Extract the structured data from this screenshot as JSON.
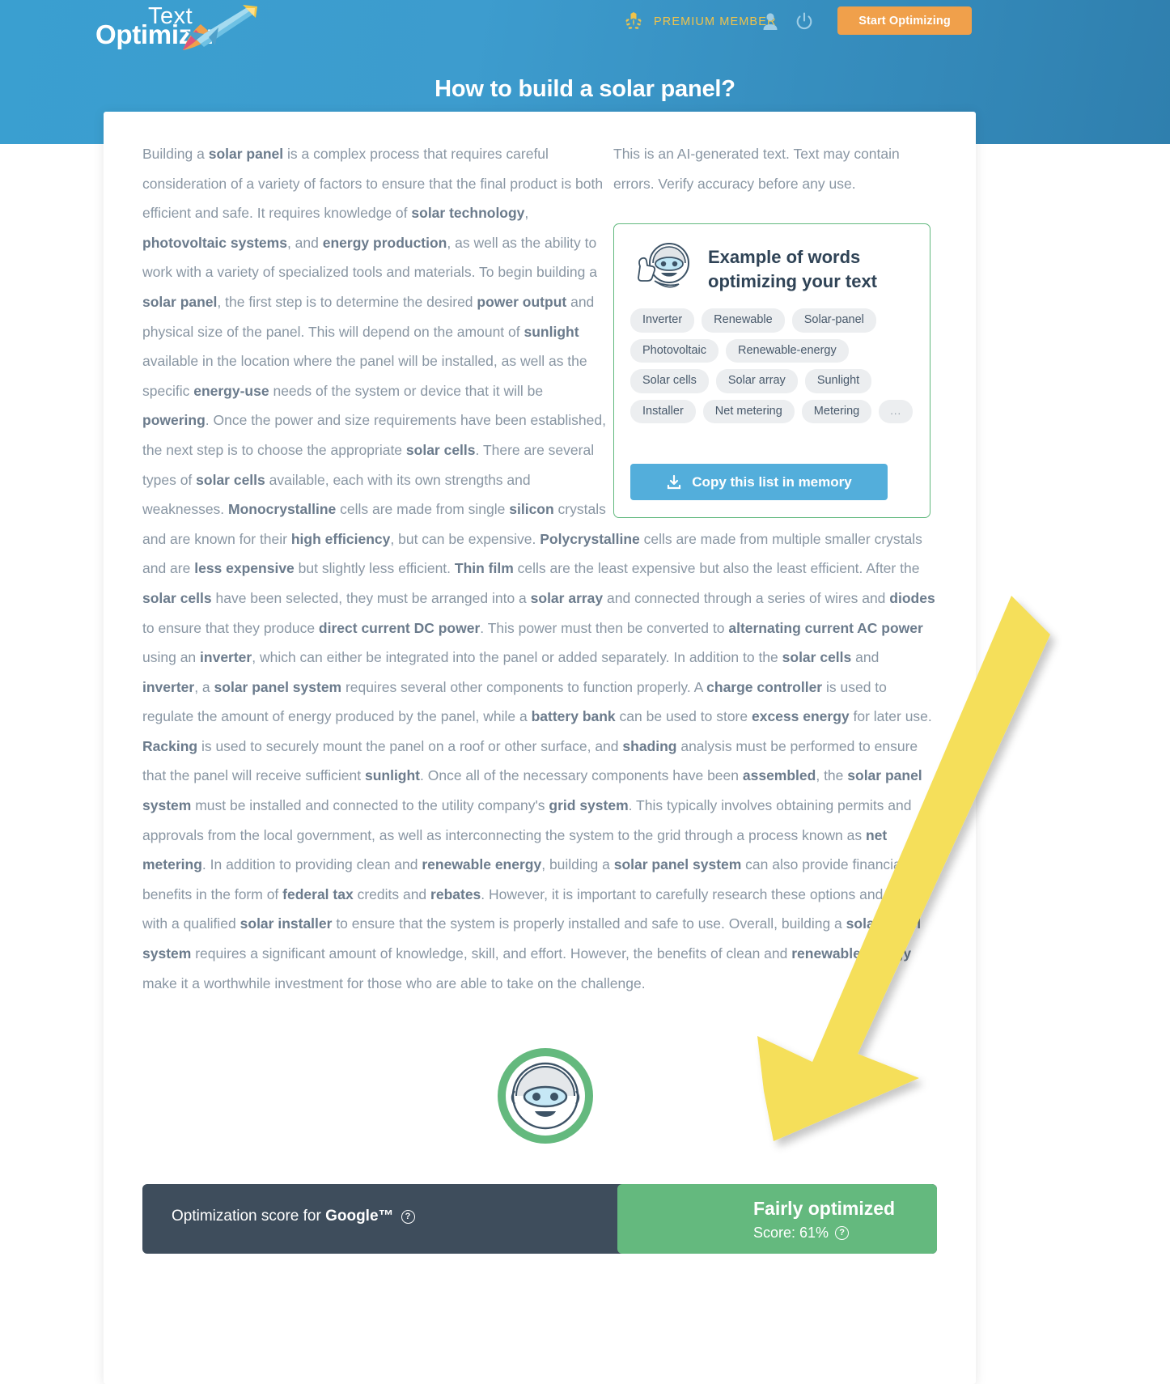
{
  "header": {
    "logo_top": "Text",
    "logo_bottom": "Optimizer",
    "premium_label": "PREMIUM MEMBER",
    "start_button": "Start Optimizing",
    "page_title": "How to build a solar panel?",
    "icons": {
      "wreath": "laurel-wreath-icon",
      "user": "user-icon",
      "power": "power-icon"
    },
    "colors": {
      "accent_orange": "#f0a04b",
      "header_blue": "#3a9fd0",
      "premium_gold": "#f0c34a"
    }
  },
  "disclaimer": "This is an AI-generated text. Text may contain errors. Verify accuracy before any use.",
  "keyword_panel": {
    "title": "Example of words optimizing your text",
    "mascot": "robot-thumbs-up-icon",
    "border_color": "#62b97f",
    "tags": [
      "Inverter",
      "Renewable",
      "Solar-panel",
      "Photovoltaic",
      "Renewable-energy",
      "Solar cells",
      "Solar array",
      "Sunlight",
      "Installer",
      "Net metering",
      "Metering",
      "..."
    ],
    "copy_button": "Copy this list in memory",
    "copy_button_icon": "download-icon",
    "copy_button_color": "#53aedb"
  },
  "score": {
    "label_prefix": "Optimization score for ",
    "label_brand": "Google™",
    "help_icon": "question-mark-icon",
    "status": "Fairly optimized",
    "score_text": "Score: 61%",
    "score_value": 61,
    "bar_color": "#3e4d5c",
    "status_color": "#64b97e",
    "avatar": "robot-face-icon"
  },
  "article": {
    "paragraph_html": "Building a <b>solar panel</b> is a complex process that requires careful consideration of a variety of factors to ensure that the final product is both efficient and safe. It requires knowledge of <b>solar technology</b>, <b>photovoltaic systems</b>, and <b>energy production</b>, as well as the ability to work with a variety of specialized tools and materials. To begin building a <b>solar panel</b>, the first step is to determine the desired <b>power output</b> and physical size of the panel. This will depend on the amount of <b>sunlight</b> available in the location where the panel will be installed, as well as the specific <b>energy-use</b> needs of the system or device that it will be <b>powering</b>. Once the power and size requirements have been established, the next step is to choose the appropriate <b>solar cells</b>. There are several types of <b>solar cells</b> available, each with its own strengths and weaknesses. <b>Monocrystalline</b> cells are made from single <b>silicon</b> crystals and are known for their <b>high efficiency</b>, but can be expensive. <b>Polycrystalline</b> cells are made from multiple smaller crystals and are <b>less expensive</b> but slightly less efficient. <b>Thin film</b> cells are the least expensive but also the least efficient. After the <b>solar cells</b> have been selected, they must be arranged into a <b>solar array</b> and connected through a series of wires and <b>diodes</b> to ensure that they produce <b>direct current DC power</b>. This power must then be converted to <b>alternating current AC power</b> using an <b>inverter</b>, which can either be integrated into the panel or added separately. In addition to the <b>solar cells</b> and <b>inverter</b>, a <b>solar panel system</b> requires several other components to function properly. A <b>charge controller</b> is used to regulate the amount of energy produced by the panel, while a <b>battery bank</b> can be used to store <b>excess energy</b> for later use. <b>Racking</b> is used to securely mount the panel on a roof or other surface, and <b>shading</b> analysis must be performed to ensure that the panel will receive sufficient <b>sunlight</b>. Once all of the necessary components have been <b>assembled</b>, the <b>solar panel system</b> must be installed and connected to the utility company's <b>grid system</b>. This typically involves obtaining permits and approvals from the local government, as well as interconnecting the system to the grid through a process known as <b>net metering</b>. In addition to providing clean and <b>renewable energy</b>, building a <b>solar panel system</b> can also provide financial benefits in the form of <b>federal tax</b> credits and <b>rebates</b>. However, it is important to carefully research these options and work with a qualified <b>solar installer</b> to ensure that the system is properly installed and safe to use. Overall, building a <b>solar panel system</b> requires a significant amount of knowledge, skill, and effort. However, the benefits of clean and <b>renewable energy</b> make it a worthwhile investment for those who are able to take on the challenge."
  },
  "annotation": {
    "arrow": "yellow-arrow-pointing-to-score",
    "color": "#f5df5a"
  }
}
